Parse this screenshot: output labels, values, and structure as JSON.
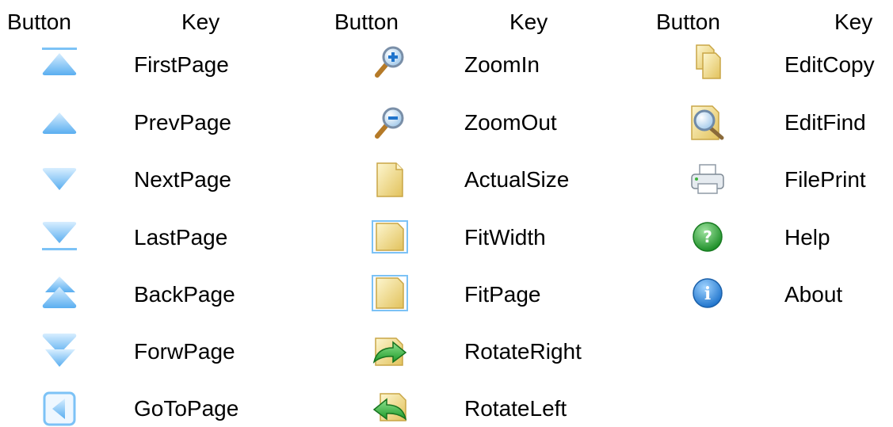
{
  "headers": {
    "button": "Button",
    "key": "Key"
  },
  "columns": [
    {
      "items": [
        {
          "icon": "first-page-icon",
          "key": "FirstPage"
        },
        {
          "icon": "prev-page-icon",
          "key": "PrevPage"
        },
        {
          "icon": "next-page-icon",
          "key": "NextPage"
        },
        {
          "icon": "last-page-icon",
          "key": "LastPage"
        },
        {
          "icon": "back-page-icon",
          "key": "BackPage"
        },
        {
          "icon": "forward-page-icon",
          "key": "ForwPage"
        },
        {
          "icon": "go-to-page-icon",
          "key": "GoToPage"
        }
      ]
    },
    {
      "items": [
        {
          "icon": "zoom-in-icon",
          "key": "ZoomIn"
        },
        {
          "icon": "zoom-out-icon",
          "key": "ZoomOut"
        },
        {
          "icon": "actual-size-icon",
          "key": "ActualSize"
        },
        {
          "icon": "fit-width-icon",
          "key": "FitWidth"
        },
        {
          "icon": "fit-page-icon",
          "key": "FitPage"
        },
        {
          "icon": "rotate-right-icon",
          "key": "RotateRight"
        },
        {
          "icon": "rotate-left-icon",
          "key": "RotateLeft"
        }
      ]
    },
    {
      "items": [
        {
          "icon": "edit-copy-icon",
          "key": "EditCopy"
        },
        {
          "icon": "edit-find-icon",
          "key": "EditFind"
        },
        {
          "icon": "file-print-icon",
          "key": "FilePrint"
        },
        {
          "icon": "help-icon",
          "key": "Help"
        },
        {
          "icon": "about-icon",
          "key": "About"
        }
      ]
    }
  ],
  "colors": {
    "blue_light": "#c9e6ff",
    "blue": "#7cc2f6",
    "blue_dark": "#3f95e0",
    "paper_light": "#fbf0b9",
    "paper": "#e8cd6e",
    "paper_edge": "#b08a2a",
    "green": "#3fb43f",
    "info_blue": "#2b86d8"
  }
}
